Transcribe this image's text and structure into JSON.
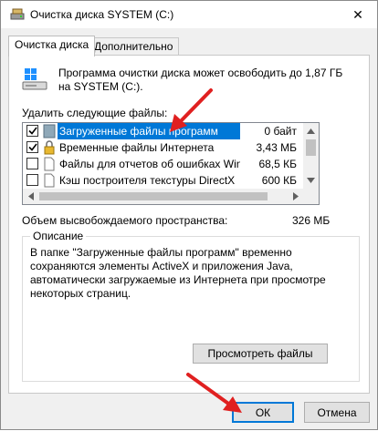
{
  "window": {
    "title": "Очистка диска  SYSTEM (C:)",
    "close_glyph": "✕"
  },
  "tabs": [
    {
      "label": "Очистка диска",
      "active": true
    },
    {
      "label": "Дополнительно",
      "active": false
    }
  ],
  "intro": "Программа очистки диска может освободить до 1,87 ГБ на SYSTEM (C:).",
  "files_label": "Удалить следующие файлы:",
  "files": [
    {
      "name": "Загруженные файлы программ",
      "size": "0 байт",
      "checked": true,
      "selected": true,
      "icon": "folder-icon"
    },
    {
      "name": "Временные файлы Интернета",
      "size": "3,43 МБ",
      "checked": true,
      "selected": false,
      "icon": "lock-icon"
    },
    {
      "name": "Файлы для отчетов об ошибках Win...",
      "size": "68,5 КБ",
      "checked": false,
      "selected": false,
      "icon": "file-icon"
    },
    {
      "name": "Кэш построителя текстуры DirectX",
      "size": "600 КБ",
      "checked": false,
      "selected": false,
      "icon": "file-icon"
    }
  ],
  "space": {
    "label": "Объем высвобождаемого пространства:",
    "value": "326 МБ"
  },
  "description": {
    "title": "Описание",
    "text": "В папке \"Загруженные файлы программ\" временно сохраняются элементы ActiveX и приложения Java, автоматически загружаемые из Интернета при просмотре некоторых страниц."
  },
  "buttons": {
    "view": "Просмотреть файлы",
    "ok": "ОК",
    "cancel": "Отмена"
  },
  "colors": {
    "selection": "#0078d7",
    "annotation_arrow": "#e02020"
  }
}
